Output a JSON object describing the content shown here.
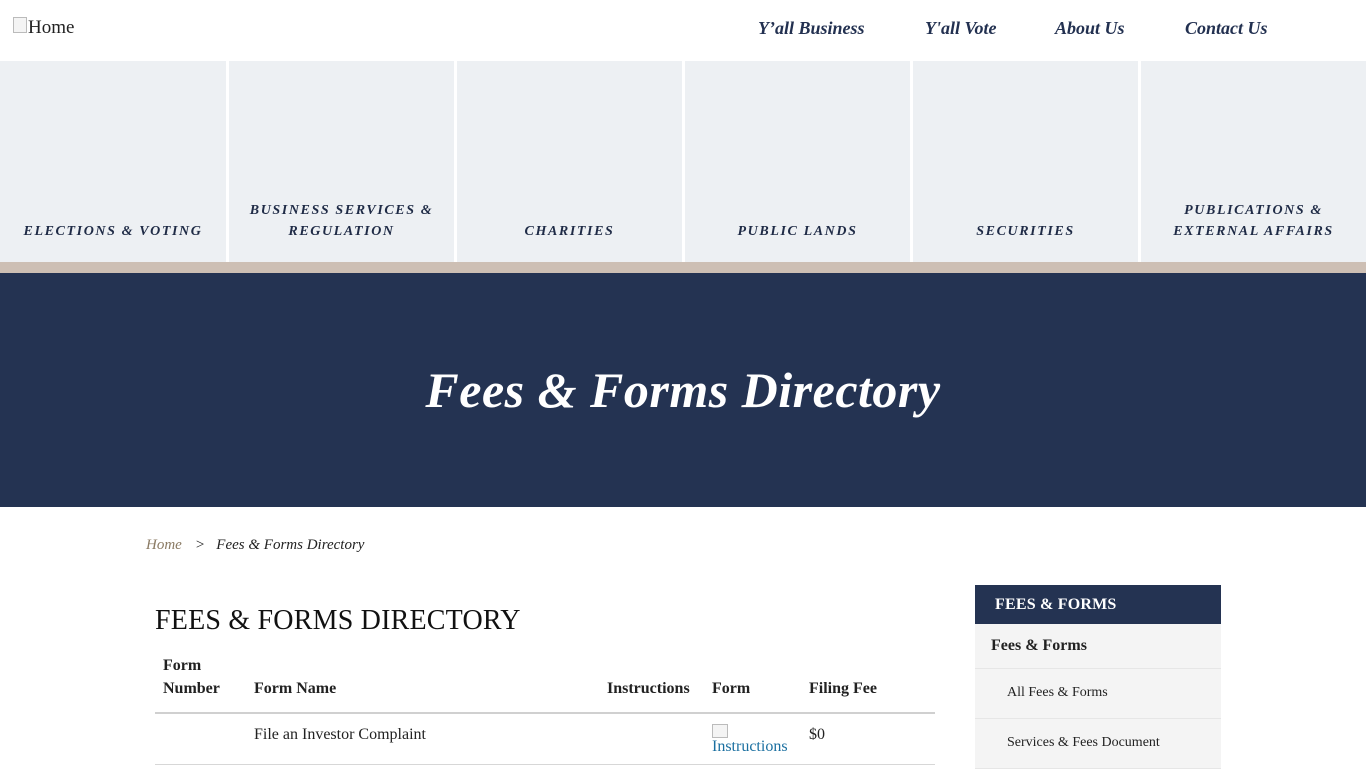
{
  "header": {
    "logo_alt": "Home",
    "nav": [
      "Y’all Business",
      "Y'all Vote",
      "About Us",
      "Contact Us"
    ]
  },
  "tiles": [
    {
      "line1": "ELECTIONS & VOTING",
      "line2": ""
    },
    {
      "line1": "BUSINESS SERVICES &",
      "line2": "REGULATION"
    },
    {
      "line1": "CHARITIES",
      "line2": ""
    },
    {
      "line1": "PUBLIC LANDS",
      "line2": ""
    },
    {
      "line1": "SECURITIES",
      "line2": ""
    },
    {
      "line1": "PUBLICATIONS &",
      "line2": "EXTERNAL AFFAIRS"
    }
  ],
  "hero": {
    "title": "Fees & Forms Directory"
  },
  "breadcrumb": {
    "home": "Home",
    "separator": ">",
    "current": "Fees & Forms Directory"
  },
  "main": {
    "title": "FEES & FORMS DIRECTORY",
    "table": {
      "headers": {
        "number_1": "Form",
        "number_2": "Number",
        "name": "Form Name",
        "instructions": "Instructions",
        "form": "Form",
        "fee": "Filing Fee"
      },
      "rows": [
        {
          "number": "",
          "name": "File an Investor Complaint",
          "instructions": "",
          "form": "Instructions",
          "fee": "$0"
        }
      ]
    }
  },
  "sidebar": {
    "heading": "FEES & FORMS",
    "section": "Fees & Forms",
    "items": [
      "All Fees & Forms",
      "Services & Fees Document"
    ]
  },
  "colors": {
    "navy": "#243352",
    "tan": "#cdbfb4",
    "tile_bg": "#edf0f3",
    "link": "#1a6fa0"
  }
}
